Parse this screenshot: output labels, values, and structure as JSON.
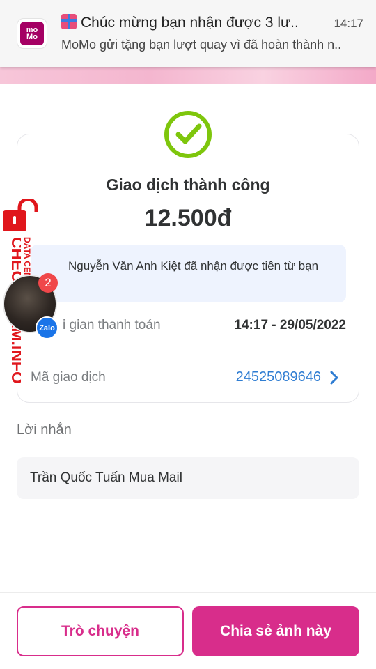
{
  "notification": {
    "app_logo_lines": [
      "mo",
      "Mo"
    ],
    "title": "Chúc mừng bạn nhận được 3 lư..",
    "body": "MoMo gửi tặng bạn lượt quay vì đã hoàn thành n..",
    "time": "14:17",
    "gift_icon": "gift-icon"
  },
  "result": {
    "status_icon": "check-circle-icon",
    "status_color": "#7ec60c",
    "title": "Giao dịch thành công",
    "amount": "12.500đ",
    "recipient_note": "Nguyễn Văn Anh Kiệt đã nhận được tiền từ bạn",
    "time_label": "i gian thanh toán",
    "time_value": "14:17 - 29/05/2022",
    "txid_label": "Mã giao dịch",
    "txid_value": "24525089646"
  },
  "message": {
    "label": "Lời nhắn",
    "text": "Trần Quốc Tuấn Mua Mail"
  },
  "footer": {
    "chat_button": "Trò chuyện",
    "share_button": "Chia sẻ ảnh này",
    "accent": "#d82d8b"
  },
  "watermark": {
    "big": "CHECKSCAM.INFO",
    "small": "DATA CENTER",
    "color": "#e0161c"
  },
  "chat_head": {
    "badge": "2",
    "app_label": "Zalo"
  }
}
